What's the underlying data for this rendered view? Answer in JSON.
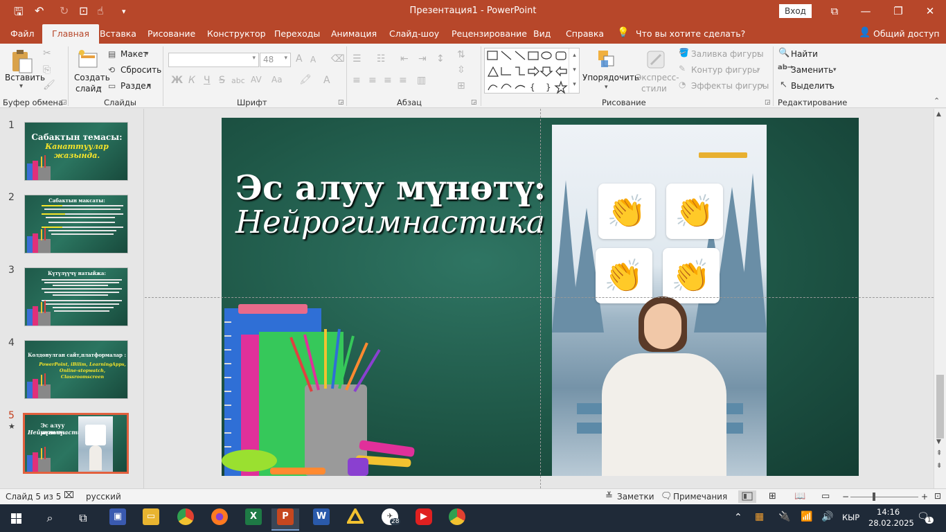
{
  "titlebar": {
    "title": "Презентация1 - PowerPoint",
    "signin": "Вход",
    "minimize": "—",
    "maximize": "❐",
    "close": "✕",
    "ribbon_display": "⧉"
  },
  "menu": {
    "tabs": [
      "Файл",
      "Главная",
      "Вставка",
      "Рисование",
      "Конструктор",
      "Переходы",
      "Анимация",
      "Слайд-шоу",
      "Рецензирование",
      "Вид",
      "Справка"
    ],
    "tell_me": "Что вы хотите сделать?",
    "share": "Общий доступ"
  },
  "ribbon": {
    "clipboard": {
      "paste": "Вставить",
      "label": "Буфер обмена"
    },
    "slides": {
      "new_slide_1": "Создать",
      "new_slide_2": "слайд",
      "layout": "Макет",
      "reset": "Сбросить",
      "section": "Раздел",
      "label": "Слайды"
    },
    "font": {
      "size": "48",
      "bold": "Ж",
      "italic": "К",
      "underline": "Ч",
      "strike": "S",
      "spacing": "abc",
      "label": "Шрифт"
    },
    "paragraph": {
      "label": "Абзац"
    },
    "drawing": {
      "arrange": "Упорядочить",
      "quick_styles_1": "Экспресс-",
      "quick_styles_2": "стили",
      "fill": "Заливка фигуры",
      "outline": "Контур фигуры",
      "effects": "Эффекты фигуры",
      "label": "Рисование"
    },
    "editing": {
      "find": "Найти",
      "replace": "Заменить",
      "select": "Выделить",
      "label": "Редактирование"
    }
  },
  "thumbnails": [
    {
      "num": "1",
      "line1": "Сабактын темасы:",
      "line2": "Канаттуулар жазында."
    },
    {
      "num": "2",
      "line1": "Сабактын максаты:",
      "line2": ""
    },
    {
      "num": "3",
      "line1": "Күтүлүүчү натыйжа:",
      "line2": ""
    },
    {
      "num": "4",
      "line1": "Колдонулган сайт,платформалар :",
      "line2": "PowerPoint, iBilim, LearningApps, Online-stopwatch, Classroomscreen"
    },
    {
      "num": "5",
      "line1": "Эс алуу мүнөтү:",
      "line2": "Нейрогимнастика"
    }
  ],
  "slide": {
    "title_line1": "Эс алуу мүнөтү:",
    "title_line2": "Нейрогимнастика"
  },
  "status": {
    "slide_counter": "Слайд 5 из 5",
    "language": "русский",
    "notes": "Заметки",
    "comments": "Примечания",
    "zoom_minus": "−",
    "zoom_plus": "+"
  },
  "taskbar": {
    "language": "КЫР",
    "time": "14:16",
    "date": "28.02.2025",
    "notifications": "1",
    "telegram_badge": "28"
  },
  "colors": {
    "accent": "#b7472a",
    "ribbon_bg": "#f3f3f3",
    "slide_green": "#1e5646",
    "taskbar": "#1f2a38"
  }
}
